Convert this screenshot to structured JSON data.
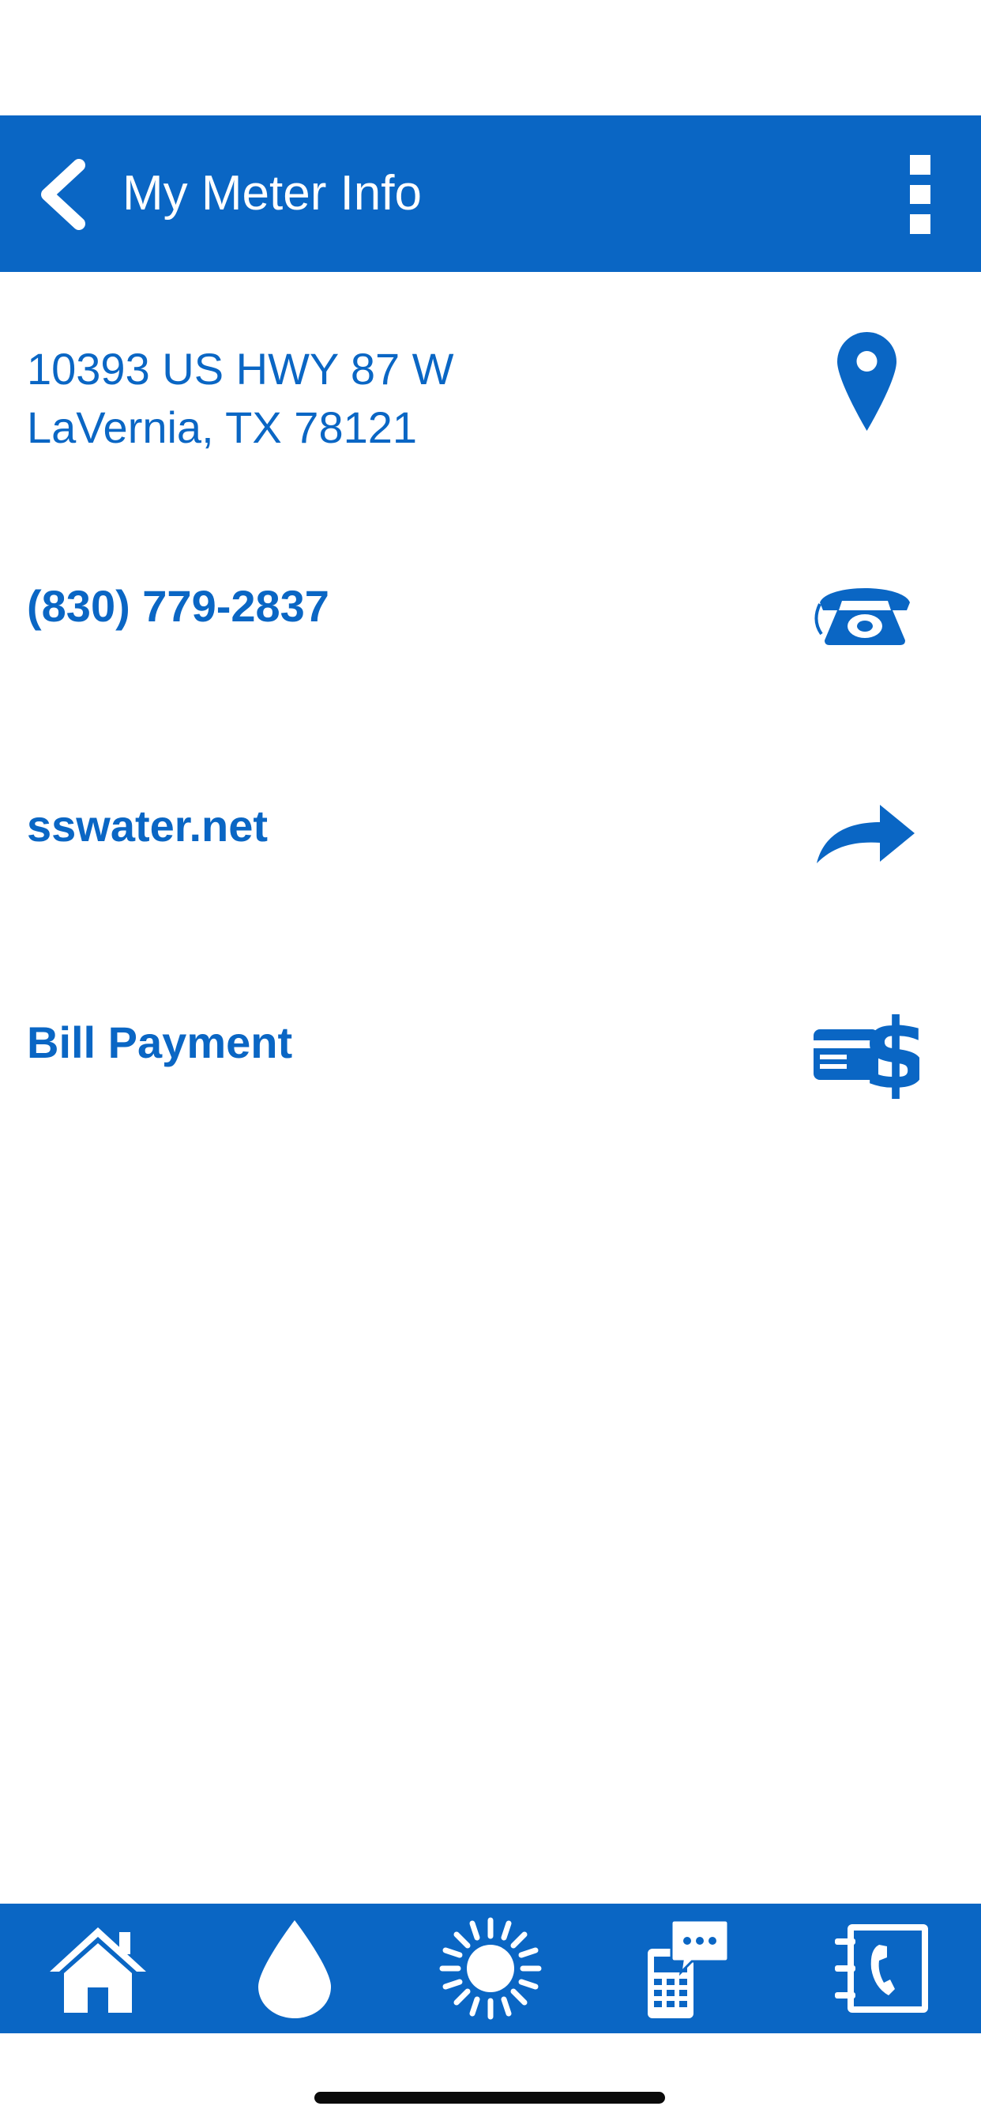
{
  "header": {
    "title": "My Meter Info",
    "back_icon": "chevron-left-icon",
    "menu_icon": "more-vertical-icon"
  },
  "info": {
    "address_line1": "10393 US HWY 87 W",
    "address_line2": "LaVernia, TX 78121",
    "address_icon": "map-pin-icon",
    "phone": "(830) 779-2837",
    "phone_icon": "telephone-icon",
    "website": "sswater.net",
    "website_icon": "share-arrow-icon",
    "bill_payment": "Bill Payment",
    "bill_icon": "card-dollar-icon"
  },
  "tabbar": {
    "tabs": [
      "home-icon",
      "water-drop-icon",
      "sun-icon",
      "phone-chat-icon",
      "contact-book-icon"
    ]
  },
  "colors": {
    "brand": "#0a66c4",
    "background": "#ffffff"
  }
}
